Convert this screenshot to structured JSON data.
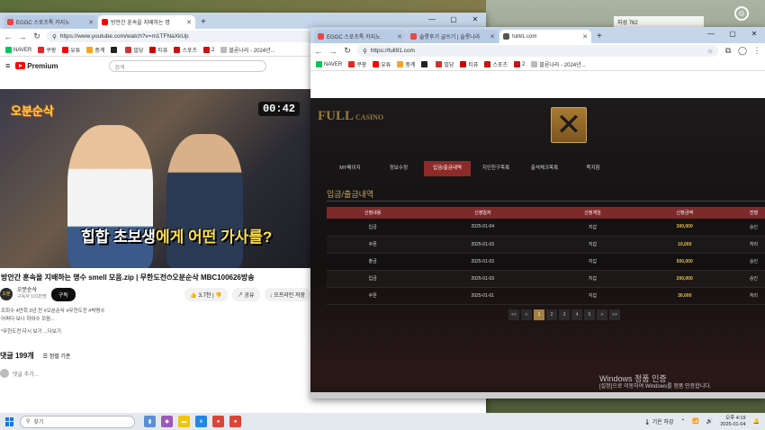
{
  "desktop": {
    "weather_label": "지성 762",
    "watermark_title": "Windows 정품 인증",
    "watermark_sub": "[설정]으로 이동하여 Windows를 정품 인증합니다."
  },
  "yt_window": {
    "tabs": [
      {
        "label": "EGGC 스포츠톡 카지노",
        "icon_color": "#e44"
      },
      {
        "label": "방안간 훈속을 지배하는 명",
        "icon_color": "#f00"
      }
    ],
    "url": "https://www.youtube.com/watch?v=m1TFNaXkUp",
    "bookmarks": [
      {
        "label": "NAVER",
        "color": "#03c75a"
      },
      {
        "label": "쿠팡",
        "color": "#e52528"
      },
      {
        "label": "유튜",
        "color": "#f00"
      },
      {
        "label": "중계",
        "color": "#f5a623"
      },
      {
        "label": "",
        "color": "#222"
      },
      {
        "label": "밀당",
        "color": "#c33"
      },
      {
        "label": "티퓨",
        "color": "#c00"
      },
      {
        "label": "스포츠",
        "color": "#c11"
      },
      {
        "label": "2",
        "color": "#c11"
      },
      {
        "label": "블론나라 - 2024년...",
        "color": "#bbb"
      }
    ],
    "premium_label": "Premium",
    "search_placeholder": "검색",
    "video": {
      "logo_text": "오분순삭",
      "timer": "00:42",
      "subtitle_plain": "힙합 초보생",
      "subtitle_highlight": "에게 어떤 가사를?"
    },
    "title": "방안간 훈속을 지배하는 명수 smell 모음.zip | 무한도전⏱오분순삭 MBC100626방송",
    "channel_name": "오분순삭",
    "channel_subs": "구독자 101만명",
    "subscribe": "구독",
    "likes": "3.7천",
    "share": "공유",
    "offline": "오프라인 저장",
    "desc_line1": "조회수 4만회  3년 전  #오분순삭 #무한도전 #박명수",
    "desc_line2": "어쩌다 보니 하와수 모음...",
    "desc_line3": "*무한도전 다시 보기 ...더보기",
    "comments_count": "댓글 199개",
    "sort_label": "정렬 기준",
    "add_comment": "댓글 추가..."
  },
  "casino_window": {
    "tabs": [
      {
        "label": "EGGC 스포츠톡 카지노",
        "icon_color": "#e44"
      },
      {
        "label": "슬롯후기 글쓰기 | 슬롯나라",
        "icon_color": "#e44"
      },
      {
        "label": "full91.com",
        "icon_color": "#555"
      }
    ],
    "url": "https://full91.com",
    "logo_main": "FULL",
    "logo_sub": "CASINO",
    "nav": [
      "MY페이지",
      "정보수정",
      "입금/출금내역",
      "지인친구목록",
      "출석체크목록",
      "쪽지함"
    ],
    "active_nav": 2,
    "section_title": "입금/출금내역",
    "columns": [
      "신청내용",
      "신청일자",
      "신청게임",
      "신청금액",
      "진행"
    ],
    "rows": [
      {
        "type": "입금",
        "date": "2025-01-04",
        "game": "지갑",
        "amount": "300,000",
        "status": "승인"
      },
      {
        "type": "쿠폰",
        "date": "2025-01-03",
        "game": "지갑",
        "amount": "10,000",
        "status": "처리"
      },
      {
        "type": "출금",
        "date": "2025-01-03",
        "game": "지갑",
        "amount": "500,000",
        "status": "승인"
      },
      {
        "type": "입금",
        "date": "2025-01-03",
        "game": "지갑",
        "amount": "200,000",
        "status": "승인"
      },
      {
        "type": "쿠폰",
        "date": "2025-01-01",
        "game": "지갑",
        "amount": "30,000",
        "status": "처리"
      }
    ],
    "pager": [
      "<<",
      "<",
      "1",
      "2",
      "3",
      "4",
      "5",
      ">",
      ">>"
    ],
    "current_page": "1"
  },
  "taskbar": {
    "search_placeholder": "찾기",
    "apps": [
      {
        "name": "files-app",
        "color": "#5b8fd6",
        "glyph": "▮"
      },
      {
        "name": "store-app",
        "color": "#9b59b6",
        "glyph": "◆"
      },
      {
        "name": "notes-app",
        "color": "#f1c40f",
        "glyph": "▬"
      },
      {
        "name": "edge-app",
        "color": "#1e88e5",
        "glyph": "e"
      },
      {
        "name": "chrome-app",
        "color": "#db4437",
        "glyph": "●"
      },
      {
        "name": "chrome2-app",
        "color": "#db4437",
        "glyph": "●"
      }
    ],
    "weather": "기온 하강",
    "time": "오후 4:19",
    "date": "2025-01-04"
  }
}
